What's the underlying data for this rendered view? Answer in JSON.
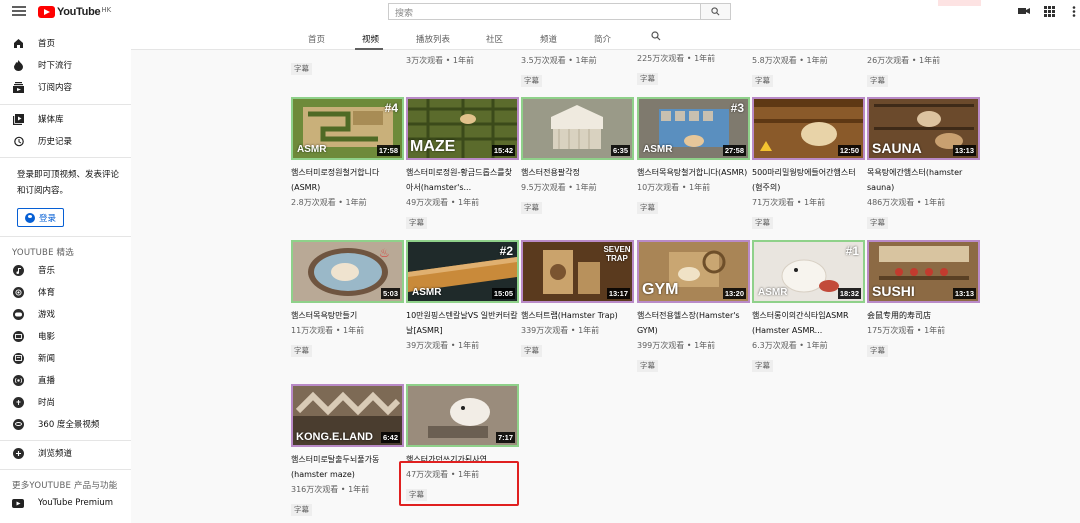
{
  "header": {
    "logo_text": "YouTube",
    "region": "HK",
    "search_placeholder": "搜索",
    "icons": [
      "menu-icon",
      "search-icon",
      "video-camera-icon",
      "apps-grid-icon",
      "more-vert-icon"
    ]
  },
  "sidebar": {
    "primary": [
      {
        "label": "首页",
        "icon": "home-icon"
      },
      {
        "label": "时下流行",
        "icon": "flame-icon"
      },
      {
        "label": "订阅内容",
        "icon": "subscriptions-icon"
      }
    ],
    "library": [
      {
        "label": "媒体库",
        "icon": "library-icon"
      },
      {
        "label": "历史记录",
        "icon": "history-icon"
      }
    ],
    "prompt": "登录即可顶视频、发表评论和订阅内容。",
    "signin_label": "登录",
    "best_heading": "YOUTUBE 精选",
    "best": [
      {
        "label": "音乐",
        "icon": "music-icon"
      },
      {
        "label": "体育",
        "icon": "sports-icon"
      },
      {
        "label": "游戏",
        "icon": "gaming-icon"
      },
      {
        "label": "电影",
        "icon": "movies-icon"
      },
      {
        "label": "新闻",
        "icon": "news-icon"
      },
      {
        "label": "直播",
        "icon": "live-icon"
      },
      {
        "label": "时尚",
        "icon": "fashion-icon"
      },
      {
        "label": "360 度全景视频",
        "icon": "360-video-icon"
      }
    ],
    "browse_label": "浏览频道",
    "more_heading": "更多YOUTUBE 产品与功能",
    "premium_label": "YouTube Premium"
  },
  "channel_tabs": [
    {
      "label": "首页",
      "active": false
    },
    {
      "label": "视频",
      "active": true
    },
    {
      "label": "播放列表",
      "active": false
    },
    {
      "label": "社区",
      "active": false
    },
    {
      "label": "频道",
      "active": false
    },
    {
      "label": "简介",
      "active": false
    }
  ],
  "partial_row": [
    {
      "meta": "",
      "cc": "字幕"
    },
    {
      "meta": "3万次观看 • 1年前",
      "cc": ""
    },
    {
      "meta": "3.5万次观看 • 1年前",
      "cc": "字幕"
    },
    {
      "meta": "225万次观看 • 1年前",
      "cc": "字幕"
    },
    {
      "meta": "5.8万次观看 • 1年前",
      "cc": "字幕"
    },
    {
      "meta": "26万次观看 • 1年前",
      "cc": "字幕"
    }
  ],
  "videos": [
    {
      "title": "햄스터미로정원철거합니다(ASMR)",
      "meta": "2.8万次观看 • 1年前",
      "cc": "",
      "duration": "17:58",
      "overlay": "ASMR",
      "badge": "#4"
    },
    {
      "title": "햄스터미로정원-황금드롭스를찾아서(hamster's...",
      "meta": "49万次观看 • 1年前",
      "cc": "字幕",
      "duration": "15:42",
      "overlay": "MAZE",
      "badge": ""
    },
    {
      "title": "햄스터전용팔각정",
      "meta": "9.5万次观看 • 1年前",
      "cc": "字幕",
      "duration": "6:35",
      "overlay": "",
      "badge": ""
    },
    {
      "title": "햄스터목욕탕철거합니다(ASMR)",
      "meta": "10万次观看 • 1年前",
      "cc": "字幕",
      "duration": "27:58",
      "overlay": "ASMR",
      "badge": "#3"
    },
    {
      "title": "500마리밀웜탕에들어간햄스터(혐주의)",
      "meta": "71万次观看 • 1年前",
      "cc": "字幕",
      "duration": "12:50",
      "overlay": "",
      "badge": ""
    },
    {
      "title": "목욕탕에간햄스터(hamster sauna)",
      "meta": "486万次观看 • 1年前",
      "cc": "字幕",
      "duration": "13:13",
      "overlay": "SAUNA",
      "badge": ""
    },
    {
      "title": "햄스터목욕탕만들기",
      "meta": "11万次观看 • 1年前",
      "cc": "字幕",
      "duration": "5:03",
      "overlay": "",
      "badge": ""
    },
    {
      "title": "10만원핑스텐칼날VS 일반커터칼날[ASMR]",
      "meta": "39万次观看 • 1年前",
      "cc": "",
      "duration": "15:05",
      "overlay": "ASMR",
      "badge": "#2"
    },
    {
      "title": "햄스터트랩(Hamster Trap)",
      "meta": "339万次观看 • 1年前",
      "cc": "字幕",
      "duration": "13:17",
      "overlay": "SEVEN TRAP",
      "badge": ""
    },
    {
      "title": "햄스터전용헬스장(Hamster's GYM)",
      "meta": "399万次观看 • 1年前",
      "cc": "字幕",
      "duration": "13:20",
      "overlay": "GYM",
      "badge": ""
    },
    {
      "title": "햄스터롱이의간식타임ASMR (Hamster ASMR...",
      "meta": "6.3万次观看 • 1年前",
      "cc": "字幕",
      "duration": "18:32",
      "overlay": "ASMR",
      "badge": "#1"
    },
    {
      "title": "会鼠专用的寿司店",
      "meta": "175万次观看 • 1年前",
      "cc": "字幕",
      "duration": "13:13",
      "overlay": "SUSHI",
      "badge": ""
    },
    {
      "title": "햄스터미로탈출두뇌풀가동(hamster maze)",
      "meta": "316万次观看 • 1年前",
      "cc": "字幕",
      "duration": "6:42",
      "overlay": "KONG.E.LAND",
      "badge": ""
    },
    {
      "title": "햄스터가던쓰기가된사연",
      "meta": "47万次观看 • 1年前",
      "cc": "字幕",
      "duration": "7:17",
      "overlay": "",
      "badge": ""
    }
  ]
}
